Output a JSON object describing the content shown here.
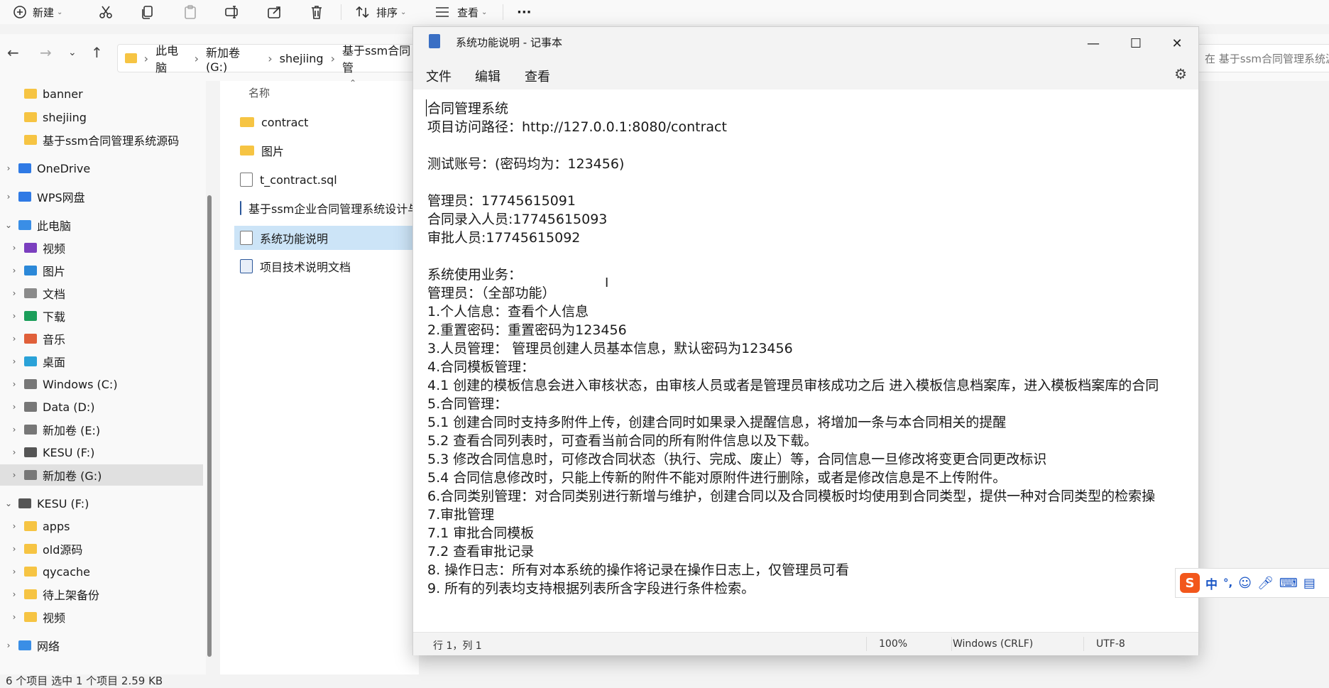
{
  "explorer": {
    "toolbar": {
      "new_label": "新建",
      "sort_label": "排序",
      "view_label": "查看",
      "more_label": "···"
    },
    "breadcrumb": [
      "此电脑",
      "新加卷 (G:)",
      "shejiing",
      "基于ssm合同管"
    ],
    "search_placeholder": "在 基于ssm合同管理系统源",
    "nav": {
      "items": [
        {
          "label": "banner",
          "icon": "folder-icon",
          "indent": 1
        },
        {
          "label": "shejiing",
          "icon": "folder-icon",
          "indent": 1
        },
        {
          "label": "基于ssm合同管理系统源码",
          "icon": "folder-icon",
          "indent": 1
        },
        {
          "label": "OneDrive",
          "icon": "cloud-icon",
          "indent": 0
        },
        {
          "label": "WPS网盘",
          "icon": "cloud-icon",
          "indent": 0
        },
        {
          "label": "此电脑",
          "icon": "computer-icon",
          "indent": 0
        },
        {
          "label": "视频",
          "icon": "video-icon",
          "indent": 1
        },
        {
          "label": "图片",
          "icon": "picture-icon",
          "indent": 1
        },
        {
          "label": "文档",
          "icon": "document-icon",
          "indent": 1
        },
        {
          "label": "下载",
          "icon": "download-icon",
          "indent": 1
        },
        {
          "label": "音乐",
          "icon": "music-icon",
          "indent": 1
        },
        {
          "label": "桌面",
          "icon": "desktop-icon",
          "indent": 1
        },
        {
          "label": "Windows (C:)",
          "icon": "drive-icon",
          "indent": 1
        },
        {
          "label": "Data (D:)",
          "icon": "drive-icon",
          "indent": 1
        },
        {
          "label": "新加卷 (E:)",
          "icon": "drive-icon",
          "indent": 1
        },
        {
          "label": "KESU  (F:)",
          "icon": "usb-drive-icon",
          "indent": 1
        },
        {
          "label": "新加卷 (G:)",
          "icon": "drive-icon",
          "indent": 1,
          "selected": true
        },
        {
          "label": "KESU  (F:)",
          "icon": "usb-drive-icon",
          "indent": 0
        },
        {
          "label": "apps",
          "icon": "folder-icon",
          "indent": 1
        },
        {
          "label": "old源码",
          "icon": "folder-icon",
          "indent": 1
        },
        {
          "label": "qycache",
          "icon": "folder-icon",
          "indent": 1
        },
        {
          "label": "待上架备份",
          "icon": "folder-icon",
          "indent": 1
        },
        {
          "label": "视频",
          "icon": "folder-icon",
          "indent": 1
        },
        {
          "label": "网络",
          "icon": "network-icon",
          "indent": 0
        }
      ]
    },
    "column_name": "名称",
    "files": [
      {
        "name": "contract",
        "type": "folder"
      },
      {
        "name": "图片",
        "type": "folder"
      },
      {
        "name": "t_contract.sql",
        "type": "file"
      },
      {
        "name": "基于ssm企业合同管理系统设计与",
        "type": "doc"
      },
      {
        "name": "系统功能说明",
        "type": "text",
        "selected": true
      },
      {
        "name": "项目技术说明文档",
        "type": "doc"
      }
    ],
    "status": "6 个项目    选中 1 个项目  2.59 KB"
  },
  "notepad": {
    "title": "系统功能说明 - 记事本",
    "menu": [
      "文件",
      "编辑",
      "查看"
    ],
    "lines": [
      "合同管理系统",
      "项目访问路径：http://127.0.0.1:8080/contract",
      "",
      "测试账号：(密码均为：123456)",
      "",
      "管理员：17745615091",
      "合同录入人员:17745615093",
      "审批人员:17745615092",
      "",
      "系统使用业务：",
      "管理员：（全部功能）",
      "1.个人信息：查看个人信息",
      "2.重置密码：重置密码为123456",
      "3.人员管理： 管理员创建人员基本信息，默认密码为123456",
      "4.合同模板管理：",
      "4.1 创建的模板信息会进入审核状态，由审核人员或者是管理员审核成功之后 进入模板信息档案库，进入模板档案库的合同",
      "5.合同管理：",
      "5.1 创建合同时支持多附件上传，创建合同时如果录入提醒信息，将增加一条与本合同相关的提醒",
      "5.2 查看合同列表时，可查看当前合同的所有附件信息以及下载。",
      "5.3 修改合同信息时，可修改合同状态（执行、完成、废止）等，合同信息一旦修改将变更合同更改标识",
      "5.4 合同信息修改时，只能上传新的附件不能对原附件进行删除，或者是修改信息是不上传附件。",
      "6.合同类别管理：对合同类别进行新增与维护，创建合同以及合同模板时均使用到合同类型，提供一种对合同类型的检索操",
      "7.审批管理",
      "7.1 审批合同模板",
      "7.2 查看审批记录",
      "8. 操作日志：所有对本系统的操作将记录在操作日志上，仅管理员可看",
      "9. 所有的列表均支持根据列表所含字段进行条件检索。"
    ],
    "status": {
      "position": "行 1，列 1",
      "zoom": "100%",
      "line_ending": "Windows (CRLF)",
      "encoding": "UTF-8"
    }
  },
  "ime": {
    "logo": "S",
    "mode": "中",
    "punct": "°,"
  }
}
